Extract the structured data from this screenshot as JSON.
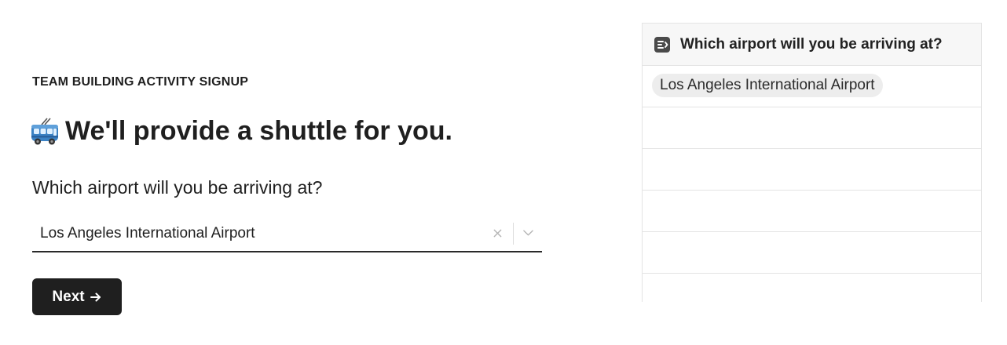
{
  "form": {
    "eyebrow": "TEAM BUILDING ACTIVITY SIGNUP",
    "heading_icon": "trolleybus-icon",
    "heading": "We'll provide a shuttle for you.",
    "question": "Which airport will you be arriving at?",
    "select": {
      "value": "Los Angeles International Airport",
      "clear_icon": "close-icon",
      "chevron_icon": "chevron-down-icon"
    },
    "next_button": {
      "label": "Next",
      "icon": "arrow-right-icon"
    }
  },
  "table": {
    "header_icon": "long-text-field-icon",
    "header": "Which airport will you be arriving at?",
    "rows": [
      {
        "value": "Los Angeles International Airport"
      },
      {
        "value": ""
      },
      {
        "value": ""
      },
      {
        "value": ""
      },
      {
        "value": ""
      },
      {
        "value": ""
      }
    ]
  },
  "colors": {
    "text": "#1f1f1f",
    "button_bg": "#1f1f1f",
    "button_text": "#ffffff",
    "tag_bg": "#ededed",
    "table_header_bg": "#f7f7f7",
    "border": "#e4e4e4",
    "bus_body": "#3b82c4"
  }
}
